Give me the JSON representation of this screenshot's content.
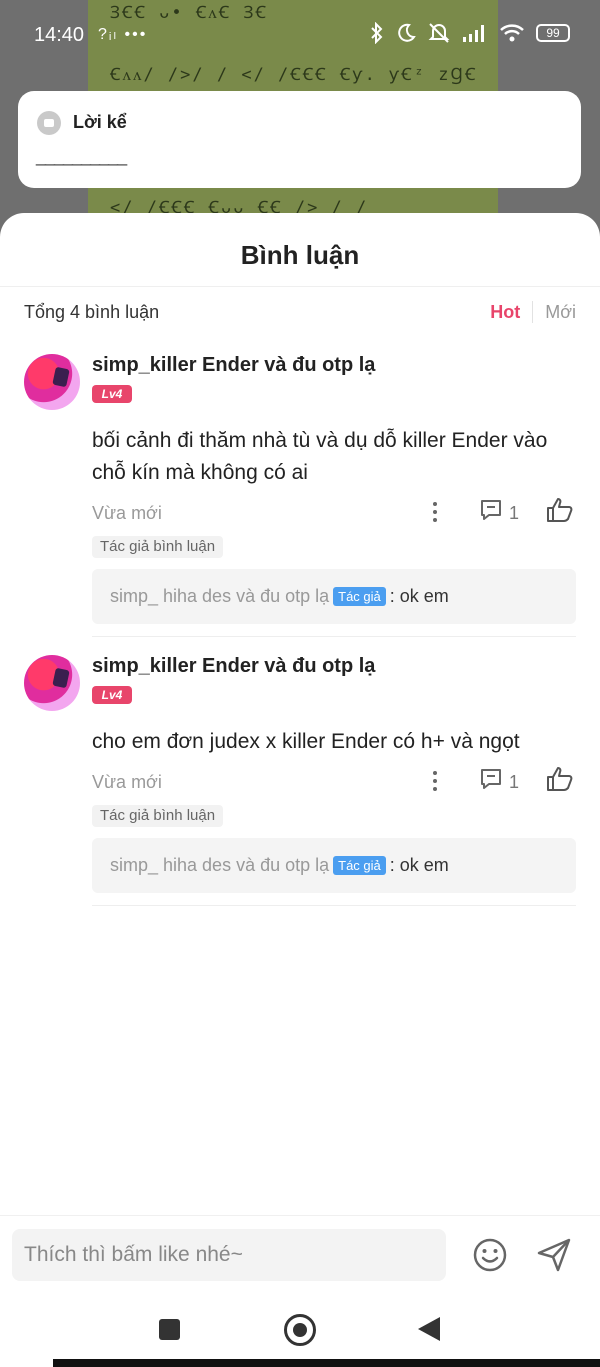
{
  "status_bar": {
    "time": "14:40",
    "left_icons": "?ᵢₗ •••",
    "battery": "99"
  },
  "background_scribbles": [
    "ꞫꞒꞒ ᴗ• ꞒᴧꞒ ꞫꞒ",
    "Ꞓᴧᴧ/ />/ / </ /ꞒꞒꞒ Ꞓƴ. ƴꞒᶻ zꞬꞒ",
    "</ /ꞒꞒꞒ Ꞓᴗᴗ ꞒꞒ /> / /"
  ],
  "narration": {
    "title": "Lời kể",
    "text": "__________"
  },
  "sheet": {
    "title": "Bình luận",
    "total": "Tổng 4 bình luận",
    "sort_hot": "Hot",
    "sort_new": "Mới"
  },
  "comments": [
    {
      "username": "simp_killer Ender và đu otp lạ",
      "level": "Lv4",
      "text": "bối cảnh đi thăm nhà tù và dụ dỗ killer Ender vào chỗ kín mà không có ai",
      "time": "Vừa mới",
      "reply_count": "1",
      "author_tag": "Tác giả bình luận",
      "reply": {
        "name": "simp_ hiha des và đu otp lạ",
        "badge": "Tác giả",
        "message": ": ok em"
      }
    },
    {
      "username": "simp_killer Ender và đu otp lạ",
      "level": "Lv4",
      "text": "cho em đơn judex x killer Ender có h+  và ngọt",
      "time": "Vừa mới",
      "reply_count": "1",
      "author_tag": "Tác giả bình luận",
      "reply": {
        "name": "simp_ hiha des và đu otp lạ",
        "badge": "Tác giả",
        "message": ": ok em"
      }
    }
  ],
  "input": {
    "placeholder": "Thích thì bấm like nhé~"
  },
  "icons": {
    "narration": "narration-icon",
    "more": "more-vertical-icon",
    "reply": "comment-icon",
    "like": "thumbs-up-icon",
    "emoji": "emoji-icon",
    "send": "send-icon"
  },
  "colors": {
    "accent_pink": "#e8456b",
    "author_badge_blue": "#4b9ef0"
  }
}
